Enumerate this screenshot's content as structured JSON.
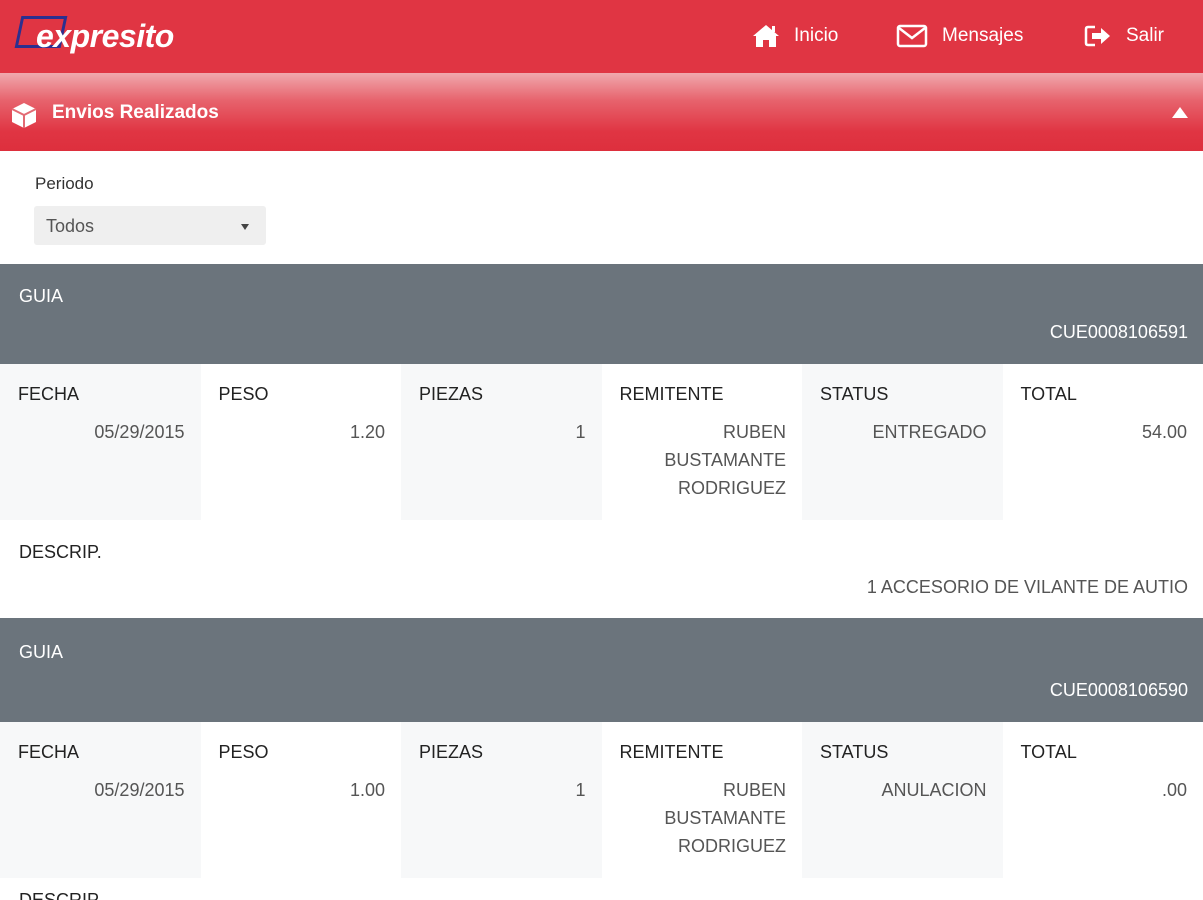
{
  "app": {
    "logo_text": "expresito"
  },
  "nav": {
    "inicio": "Inicio",
    "mensajes": "Mensajes",
    "salir": "Salir"
  },
  "section": {
    "title": "Envios Realizados"
  },
  "filter": {
    "label": "Periodo",
    "selected": "Todos"
  },
  "columns": [
    "FECHA",
    "PESO",
    "PIEZAS",
    "REMITENTE",
    "STATUS",
    "TOTAL"
  ],
  "guias": [
    {
      "label": "GUIA",
      "number": "CUE0008106591",
      "fecha": "05/29/2015",
      "peso": "1.20",
      "piezas": "1",
      "remitente": "RUBEN BUSTAMANTE RODRIGUEZ",
      "status": "ENTREGADO",
      "total": "54.00",
      "descrip_label": "DESCRIP.",
      "descrip": "1 ACCESORIO DE VILANTE DE AUTIO"
    },
    {
      "label": "GUIA",
      "number": "CUE0008106590",
      "fecha": "05/29/2015",
      "peso": "1.00",
      "piezas": "1",
      "remitente": "RUBEN BUSTAMANTE RODRIGUEZ",
      "status": "ANULACION",
      "total": ".00",
      "descrip_label": "DESCRIP."
    }
  ]
}
